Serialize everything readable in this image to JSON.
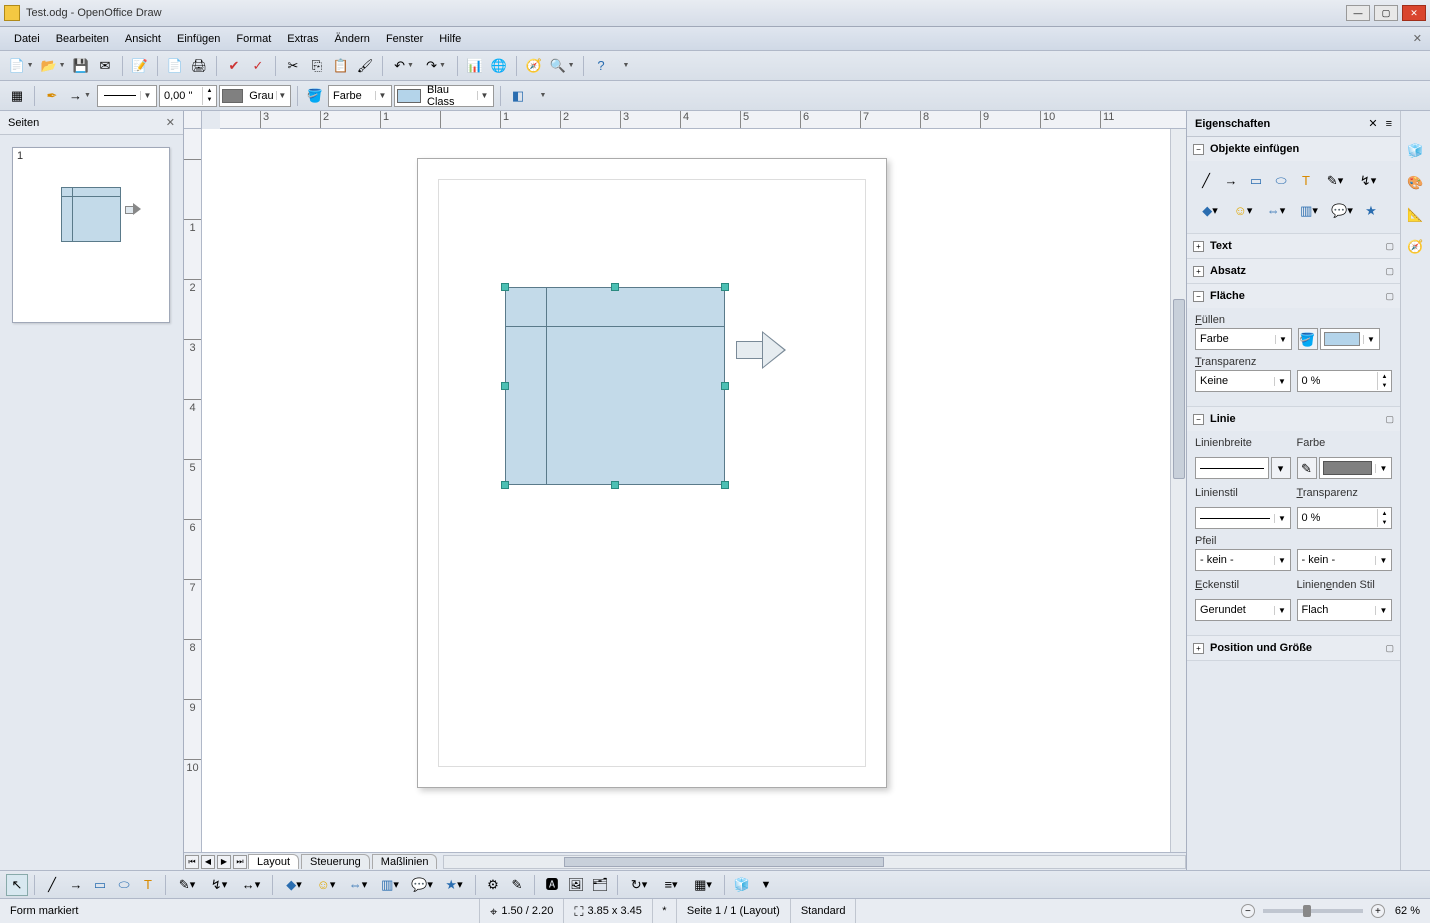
{
  "title": "Test.odg - OpenOffice Draw",
  "menus": [
    "Datei",
    "Bearbeiten",
    "Ansicht",
    "Einfügen",
    "Format",
    "Extras",
    "Ändern",
    "Fenster",
    "Hilfe"
  ],
  "toolbar2": {
    "linewidth": "0,00 \"",
    "linecolor_label": "Grau",
    "linecolor": "#808080",
    "fillmode": "Farbe",
    "fillcolor_label": "Blau Class",
    "fillcolor": "#b4d4ea"
  },
  "pages_panel": {
    "title": "Seiten",
    "page_number": "1"
  },
  "ruler_h": [
    "3",
    "2",
    "1",
    "",
    "1",
    "2",
    "3",
    "4",
    "5",
    "6",
    "7",
    "8",
    "9",
    "10",
    "11"
  ],
  "ruler_v": [
    "",
    "1",
    "2",
    "3",
    "4",
    "5",
    "6",
    "7",
    "8",
    "9",
    "10"
  ],
  "doc_tabs": [
    "Layout",
    "Steuerung",
    "Maßlinien"
  ],
  "properties": {
    "title": "Eigenschaften",
    "section_objects": "Objekte einfügen",
    "section_text": "Text",
    "section_paragraph": "Absatz",
    "section_area": "Fläche",
    "area": {
      "fill_label": "Füllen",
      "fill_mode": "Farbe",
      "fill_color": "#b4d4ea",
      "transp_label": "Transparenz",
      "transp_mode": "Keine",
      "transp_value": "0 %"
    },
    "section_line": "Linie",
    "line": {
      "width_label": "Linienbreite",
      "color_label": "Farbe",
      "color": "#808080",
      "style_label": "Linienstil",
      "transp_label": "Transparenz",
      "transp_value": "0 %",
      "arrow_label": "Pfeil",
      "arrow_start": "- kein -",
      "arrow_end": "- kein -",
      "corner_label": "Eckenstil",
      "corner": "Gerundet",
      "cap_label": "Linienenden Stil",
      "cap": "Flach"
    },
    "section_pos": "Position und Größe"
  },
  "status": {
    "selection": "Form markiert",
    "pos": "1.50 / 2.20",
    "size": "3.85 x 3.45",
    "modified": "*",
    "page": "Seite 1 / 1 (Layout)",
    "mode": "Standard",
    "zoom": "62 %"
  }
}
